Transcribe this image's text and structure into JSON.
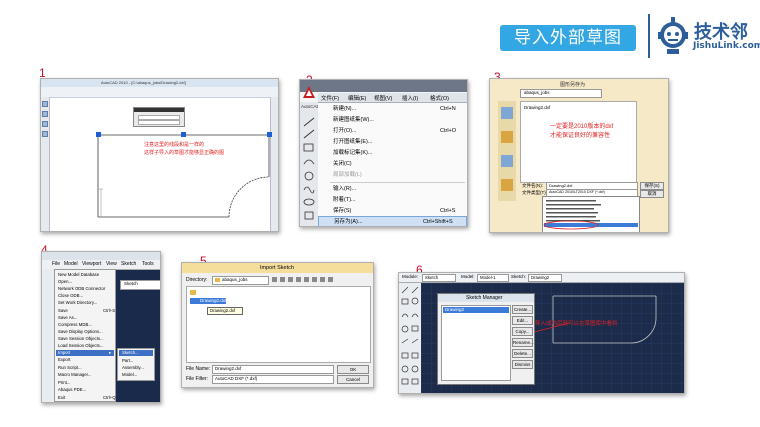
{
  "header": {
    "title": "导入外部草图",
    "logo_cn": "技术邻",
    "logo_en": "JishuLink.com"
  },
  "colors": {
    "title_bg": "#33a7e3",
    "brand": "#2b5e9a",
    "step_number": "#c8102e",
    "annotation": "#e02020"
  },
  "steps": [
    {
      "number": "1",
      "note_line1": "注意这里的线段和是一样的",
      "note_line2": "这样子导入的草图才能够显正确的图",
      "window_title": "AutoCAD 2010 - [C:\\abaqus_jobs\\Drawing2.dxf]"
    },
    {
      "number": "2",
      "menu_bar": [
        "文件(F)",
        "编辑(E)",
        "视图(V)",
        "插入(I)",
        "格式(O)"
      ],
      "menu_items": [
        {
          "label": "新建(N)...",
          "shortcut": "Ctrl+N"
        },
        {
          "label": "新建图纸集(W)...",
          "shortcut": ""
        },
        {
          "label": "打开(O)...",
          "shortcut": "Ctrl+O"
        },
        {
          "label": "打开图纸集(E)...",
          "shortcut": ""
        },
        {
          "label": "加载标记集(K)...",
          "shortcut": ""
        },
        {
          "label": "关闭(C)",
          "shortcut": ""
        },
        {
          "label": "局部加载(L)",
          "shortcut": ""
        },
        {
          "label": "输入(R)...",
          "shortcut": ""
        },
        {
          "label": "附着(T)...",
          "shortcut": ""
        },
        {
          "label": "保存(S)",
          "shortcut": "Ctrl+S"
        },
        {
          "label": "另存为(A)...",
          "shortcut": "Ctrl+Shift+S"
        },
        {
          "label": "电子传递(T)...",
          "shortcut": ""
        }
      ],
      "side_tab": "AutoCAD"
    },
    {
      "number": "3",
      "window_title": "图形另存为",
      "note_line1": "一定要是2010版本的dxf",
      "note_line2": "才能保证良好的兼容性",
      "file_name_label": "文件名(N):",
      "file_name_value": "Drawing2.dxf",
      "file_type_label": "文件类型(T):",
      "file_type_value": "AutoCAD 2010/LT2010 DXF (*.dxf)",
      "file_item": "Drawing2.dxf",
      "save_button": "保存(S)",
      "cancel_button": "取消",
      "folder": "abaqus_jobs"
    },
    {
      "number": "4",
      "menu_bar": [
        "File",
        "Model",
        "Viewport",
        "View",
        "Sketch",
        "Tools"
      ],
      "menu_items": [
        "New Model Database",
        "Open...",
        "Network ODB Connector",
        "Close ODB...",
        "Set Work Directory...",
        "Save",
        "Save As...",
        "Compress MDB...",
        "Save Display Options...",
        "Save Session Objects...",
        "Load Session Objects...",
        "Import",
        "Export",
        "Run Script...",
        "Macro Manager...",
        "Print...",
        "Abaqus PDE...",
        "Exit"
      ],
      "shortcuts": {
        "Open...": "Ctrl+O",
        "Save": "Ctrl+S",
        "Print...": "Ctrl+P",
        "Exit": "Ctrl+Q"
      },
      "submenu_items": [
        "Sketch...",
        "Part...",
        "Assembly...",
        "Model..."
      ],
      "sketch_combo": "Sketch"
    },
    {
      "number": "5",
      "window_title": "Import Sketch",
      "directory_label": "Directory:",
      "directory_value": "abaqus_jobs",
      "file_item": "Drawing2.dxf",
      "tooltip": "Drawing2.dxf",
      "file_name_label": "File Name:",
      "file_name_value": "Drawing2.dxf",
      "file_filter_label": "File Filter:",
      "file_filter_value": "AutoCAD DXF (*.dxf)",
      "ok_button": "OK",
      "cancel_button": "Cancel"
    },
    {
      "number": "6",
      "top_bar": {
        "module_label": "Module:",
        "module_value": "Sketch",
        "model_label": "Model:",
        "model_value": "Model-1",
        "sketch_label": "Sketch:",
        "sketch_value": "Drawing2"
      },
      "dialog_title": "Sketch Manager",
      "list_item": "Drawing2",
      "buttons": [
        "Create...",
        "Edit...",
        "Copy...",
        "Rename...",
        "Delete...",
        "Dismiss"
      ],
      "note": "导入成功后就可以在草图库中看到"
    }
  ]
}
